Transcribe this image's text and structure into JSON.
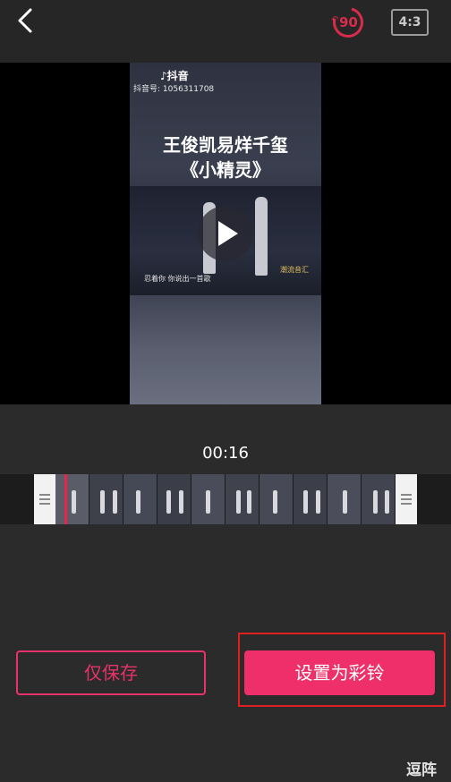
{
  "header": {
    "back_label": "<",
    "rotate_label": "90",
    "ratio_label": "4:3"
  },
  "video": {
    "app_logo": "♪抖音",
    "account_id": "抖音号: 1056311708",
    "title_line1": "王俊凯易烊千玺",
    "title_line2": "《小精灵》",
    "subtitle_snippet": "忍着你  你说出一首歌",
    "channel_mark": "潮流音汇"
  },
  "timeline": {
    "current_time": "00:16"
  },
  "actions": {
    "save_only_label": "仅保存",
    "set_ringtone_label": "设置为彩铃"
  },
  "watermark": "逗阵",
  "colors": {
    "accent": "#ee2f69",
    "highlight": "#e02020",
    "background": "#2b2b2b"
  }
}
